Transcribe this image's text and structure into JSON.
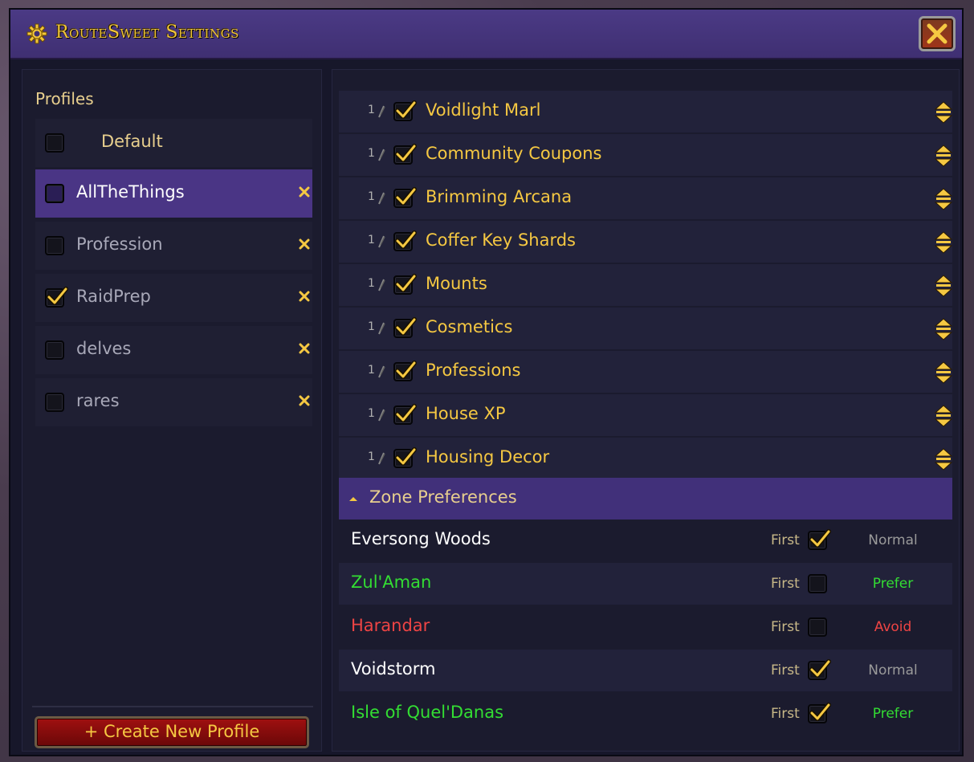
{
  "window": {
    "title": "RouteSweet Settings"
  },
  "colors": {
    "accent_gold": "#f5c842",
    "header_purple": "#4b3a85",
    "selected_purple": "#4a3585",
    "prefer_green": "#33dd33",
    "avoid_red": "#ee4444",
    "normal_gray": "#9a9a9a"
  },
  "sidebar": {
    "heading": "Profiles",
    "profiles": [
      {
        "name": "Default",
        "checked": false,
        "selected": false,
        "deletable": false
      },
      {
        "name": "AllTheThings",
        "checked": false,
        "selected": true,
        "deletable": true
      },
      {
        "name": "Profession",
        "checked": false,
        "selected": false,
        "deletable": true
      },
      {
        "name": "RaidPrep",
        "checked": true,
        "selected": false,
        "deletable": true
      },
      {
        "name": "delves",
        "checked": false,
        "selected": false,
        "deletable": true
      },
      {
        "name": "rares",
        "checked": false,
        "selected": false,
        "deletable": true
      }
    ],
    "create_button": "+ Create New Profile"
  },
  "categories": [
    {
      "num": "1",
      "label": "Voidlight Marl",
      "checked": true
    },
    {
      "num": "1",
      "label": "Community Coupons",
      "checked": true
    },
    {
      "num": "1",
      "label": "Brimming Arcana",
      "checked": true
    },
    {
      "num": "1",
      "label": "Coffer Key Shards",
      "checked": true
    },
    {
      "num": "1",
      "label": "Mounts",
      "checked": true
    },
    {
      "num": "1",
      "label": "Cosmetics",
      "checked": true
    },
    {
      "num": "1",
      "label": "Professions",
      "checked": true
    },
    {
      "num": "1",
      "label": "House XP",
      "checked": true
    },
    {
      "num": "1",
      "label": "Housing Decor",
      "checked": true
    }
  ],
  "zone_section": {
    "title": "Zone Preferences",
    "first_label": "First",
    "zones": [
      {
        "name": "Eversong Woods",
        "name_color": "#ffffff",
        "first": true,
        "pref": "Normal",
        "pref_color": "#9a9a9a"
      },
      {
        "name": "Zul'Aman",
        "name_color": "#33dd33",
        "first": false,
        "pref": "Prefer",
        "pref_color": "#33dd33"
      },
      {
        "name": "Harandar",
        "name_color": "#ee4444",
        "first": false,
        "pref": "Avoid",
        "pref_color": "#ee4444"
      },
      {
        "name": "Voidstorm",
        "name_color": "#ffffff",
        "first": true,
        "pref": "Normal",
        "pref_color": "#9a9a9a"
      },
      {
        "name": "Isle of Quel'Danas",
        "name_color": "#33dd33",
        "first": true,
        "pref": "Prefer",
        "pref_color": "#33dd33"
      }
    ]
  }
}
